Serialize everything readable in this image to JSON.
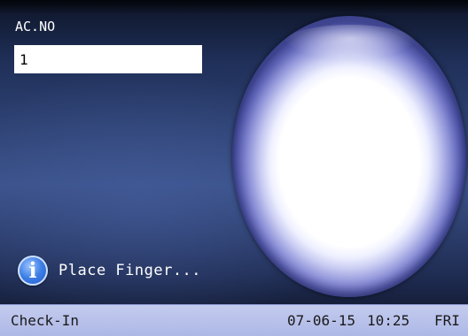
{
  "login": {
    "label": "AC.NO",
    "value": "1"
  },
  "prompt": {
    "icon": "info-icon",
    "icon_glyph": "i",
    "text": "Place Finger..."
  },
  "status_bar": {
    "mode": "Check-In",
    "date": "07-06-15",
    "time": "10:25",
    "day": "FRI"
  },
  "colors": {
    "background": "#2c3f70",
    "status_bar": "#b7c0ea",
    "finger_area": "#ffffff",
    "info_icon": "#2f6cd8"
  }
}
